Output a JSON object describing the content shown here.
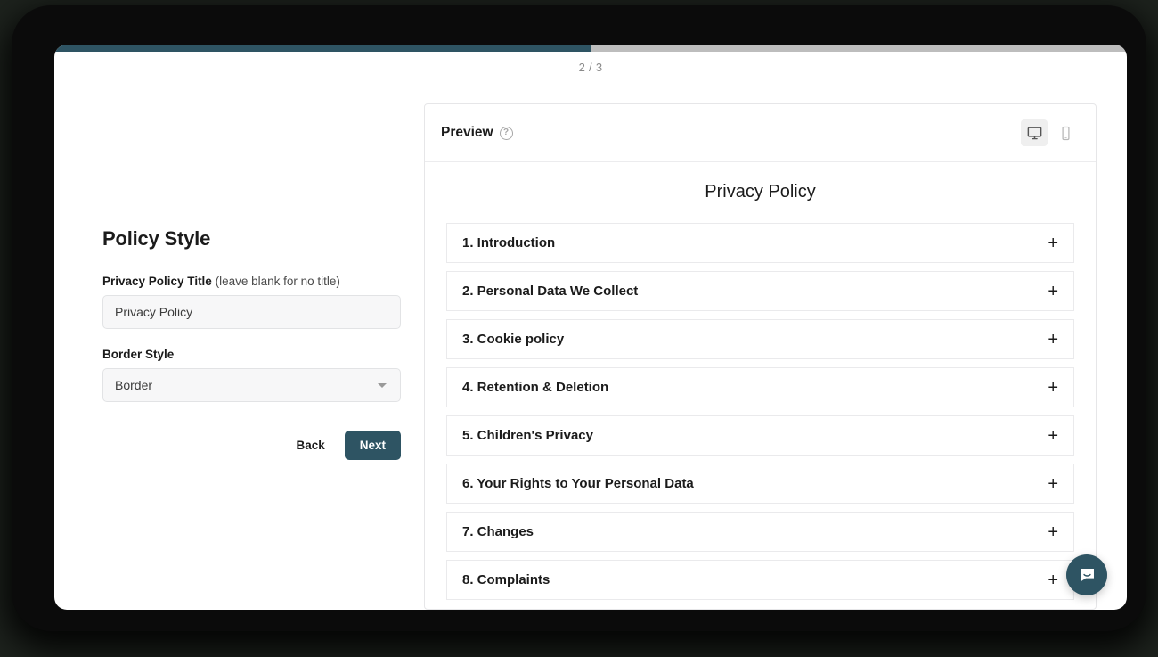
{
  "wizard": {
    "step_indicator": "2 / 3",
    "progress_percent": 50,
    "accent_color": "#2e5463"
  },
  "form": {
    "title": "Policy Style",
    "policy_title_label": "Privacy Policy Title",
    "policy_title_hint": "(leave blank for no title)",
    "policy_title_value": "Privacy Policy",
    "policy_title_placeholder": "Privacy Policy",
    "border_style_label": "Border Style",
    "border_style_value": "Border",
    "back_label": "Back",
    "next_label": "Next"
  },
  "preview": {
    "label": "Preview",
    "help_icon": "?",
    "desktop_icon": "monitor-icon",
    "mobile_icon": "phone-icon",
    "active_device": "desktop",
    "policy_title": "Privacy Policy",
    "expand_glyph": "+",
    "sections": [
      {
        "label": "1. Introduction"
      },
      {
        "label": "2. Personal Data We Collect"
      },
      {
        "label": "3. Cookie policy"
      },
      {
        "label": "4. Retention & Deletion"
      },
      {
        "label": "5. Children's Privacy"
      },
      {
        "label": "6. Your Rights to Your Personal Data"
      },
      {
        "label": "7. Changes"
      },
      {
        "label": "8. Complaints"
      }
    ]
  },
  "chat": {
    "launcher_icon": "chat-bubble-icon"
  }
}
